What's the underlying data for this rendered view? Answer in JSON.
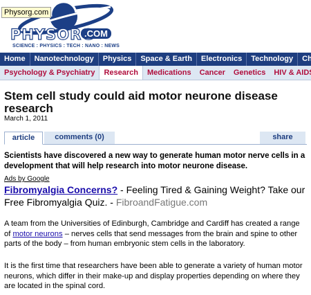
{
  "tooltip": "Physorg.com",
  "logo": {
    "word": "PHYSORG",
    "com": ".COM",
    "tagline": "SCIENCE : PHYSICS : TECH : NANO : NEWS"
  },
  "nav_main": [
    "Home",
    "Nanotechnology",
    "Physics",
    "Space & Earth",
    "Electronics",
    "Technology",
    "Chemistry"
  ],
  "nav_sub": [
    "Psychology & Psychiatry",
    "Research",
    "Medications",
    "Cancer",
    "Genetics",
    "HIV & AIDS",
    "D"
  ],
  "article": {
    "title": "Stem cell study could aid motor neurone disease research",
    "date": "March 1, 2011",
    "tabs": {
      "article": "article",
      "comments": "comments (0)",
      "share": "share"
    },
    "lead": "Scientists have discovered a new way to generate human motor nerve cells in a development that will help research into motor neurone disease.",
    "p1_before": "A team from the Universities of Edinburgh, Cambridge and Cardiff has created a range of ",
    "p1_link": "motor neurons",
    "p1_after": " – nerves cells that send messages from the brain and spine to other parts of the body – from human embryonic stem cells in the laboratory.",
    "p2": "It is the first time that researchers have been able to generate a variety of human motor neurons, which differ in their make-up and display properties depending on where they are located in the spinal cord."
  },
  "ad": {
    "ads_by": "Ads by Google",
    "link": "Fibromyalgia Concerns?",
    "text": " - Feeling Tired & Gaining Weight? Take our Free Fibromyalgia Quiz. - ",
    "domain": "FibroandFatigue.com"
  },
  "colors": {
    "nav_bg": "#1e3e80",
    "sub_nav_bg": "#dde7f3",
    "sub_nav_text": "#b00e3d",
    "link": "#1a0dab"
  }
}
